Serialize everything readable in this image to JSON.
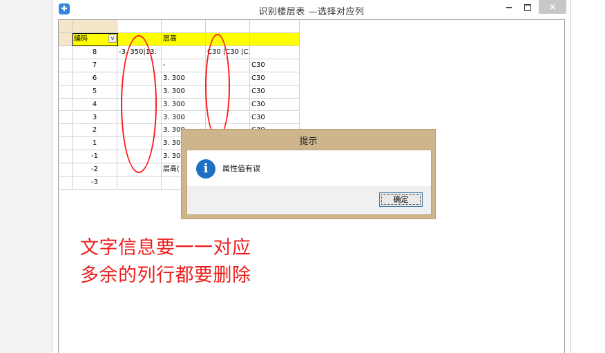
{
  "window": {
    "title": "识别楼层表 —选择对应列",
    "app_icon": "app-logo-icon",
    "min_icon": "minimize-icon",
    "max_icon": "maximize-icon",
    "close_label": "×"
  },
  "grid": {
    "header_combo": {
      "value": "编码",
      "arrow": "v"
    },
    "header_labels": [
      "",
      "层高",
      "",
      ""
    ],
    "rows": [
      {
        "code": "8",
        "c1": "-3. 350|13.",
        "c2": "",
        "c3": "C30 |C30 |C3",
        "c4": ""
      },
      {
        "code": "7",
        "c1": "",
        "c2": "-",
        "c3": "",
        "c4": "C30"
      },
      {
        "code": "6",
        "c1": "",
        "c2": "3. 300",
        "c3": "",
        "c4": "C30"
      },
      {
        "code": "5",
        "c1": "",
        "c2": "3. 300",
        "c3": "",
        "c4": "C30"
      },
      {
        "code": "4",
        "c1": "",
        "c2": "3. 300",
        "c3": "",
        "c4": "C30"
      },
      {
        "code": "3",
        "c1": "",
        "c2": "3. 300",
        "c3": "",
        "c4": "C30"
      },
      {
        "code": "2",
        "c1": "",
        "c2": "3. 300",
        "c3": "",
        "c4": "C30"
      },
      {
        "code": "1",
        "c1": "",
        "c2": "3. 300",
        "c3": "",
        "c4": ""
      },
      {
        "code": "-1",
        "c1": "",
        "c2": "3. 300",
        "c3": "",
        "c4": ""
      },
      {
        "code": "-2",
        "c1": "",
        "c2": "层高(",
        "c3": "",
        "c4": ""
      },
      {
        "code": "-3",
        "c1": "",
        "c2": "",
        "c3": "",
        "c4": ""
      }
    ]
  },
  "annotation": {
    "line1": "文字信息要一一对应",
    "line2": "多余的列行都要删除",
    "color": "#ee1c1c"
  },
  "dialog": {
    "title": "提示",
    "icon": "info-icon",
    "icon_glyph": "i",
    "message": "属性值有误",
    "ok_label": "确定"
  }
}
